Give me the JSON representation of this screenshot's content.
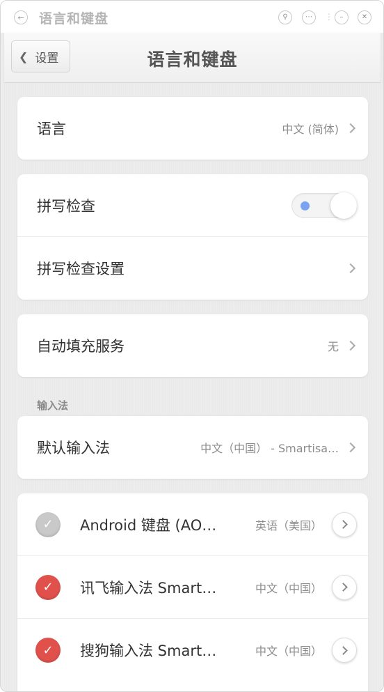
{
  "window": {
    "title": "语言和键盘",
    "back_icon": "back-arrow-icon",
    "controls": [
      "pin-icon",
      "more-icon",
      "minimize-icon",
      "close-icon"
    ]
  },
  "header": {
    "back_label": "设置",
    "title": "语言和键盘"
  },
  "language": {
    "label": "语言",
    "value": "中文 (简体)"
  },
  "spellcheck": {
    "label": "拼写检查",
    "enabled": true,
    "settings_label": "拼写检查设置"
  },
  "autofill": {
    "label": "自动填充服务",
    "value": "无"
  },
  "input_methods": {
    "section_label": "输入法",
    "default_label": "默认输入法",
    "default_value": "中文（中国） - Smartisa…",
    "items": [
      {
        "name": "Android 键盘 (AO…",
        "lang": "英语（美国）",
        "checked": false
      },
      {
        "name": "讯飞输入法 Smart…",
        "lang": "中文（中国）",
        "checked": true
      },
      {
        "name": "搜狗输入法 Smart…",
        "lang": "中文（中国）",
        "checked": true
      }
    ]
  },
  "colors": {
    "accent_blue": "#7aa2f2",
    "checked_red": "#e0514c",
    "unchecked_gray": "#c9c9c9"
  }
}
